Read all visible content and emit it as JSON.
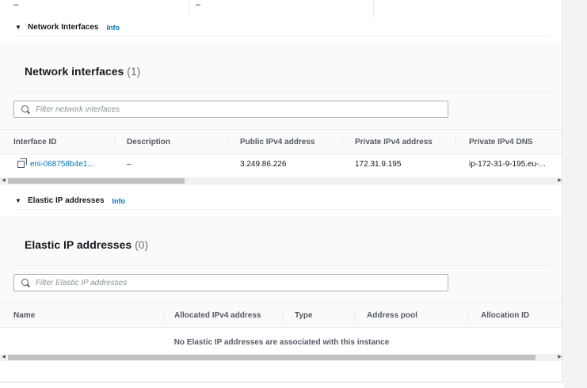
{
  "top_row": {
    "col1": "–",
    "col2": "–"
  },
  "network_section": {
    "header": "Network Interfaces",
    "info": "Info",
    "card_title": "Network interfaces",
    "count": "(1)",
    "filter_placeholder": "Filter network interfaces",
    "columns": [
      "Interface ID",
      "Description",
      "Public IPv4 address",
      "Private IPv4 address",
      "Private IPv4 DNS"
    ],
    "rows": [
      {
        "interface_id": "eni-068758b4e1...",
        "description": "–",
        "public_ipv4": "3.249.86.226",
        "private_ipv4": "172.31.9.195",
        "private_dns": "ip-172-31-9-195.eu-..."
      }
    ]
  },
  "eip_section": {
    "header": "Elastic IP addresses",
    "info": "Info",
    "card_title": "Elastic IP addresses",
    "count": "(0)",
    "filter_placeholder": "Filter Elastic IP addresses",
    "columns": [
      "Name",
      "Allocated IPv4 address",
      "Type",
      "Address pool",
      "Allocation ID"
    ],
    "empty_message": "No Elastic IP addresses are associated with this instance"
  },
  "icons": {
    "caret": "caret-down-icon",
    "search": "search-icon",
    "copy": "copy-icon",
    "scroll_left": "scroll-left-arrow-icon",
    "scroll_right": "scroll-right-arrow-icon"
  },
  "colors": {
    "link": "#0073bb",
    "header_text": "#545b64",
    "card_bg": "#fafafa",
    "border": "#eaeded"
  }
}
